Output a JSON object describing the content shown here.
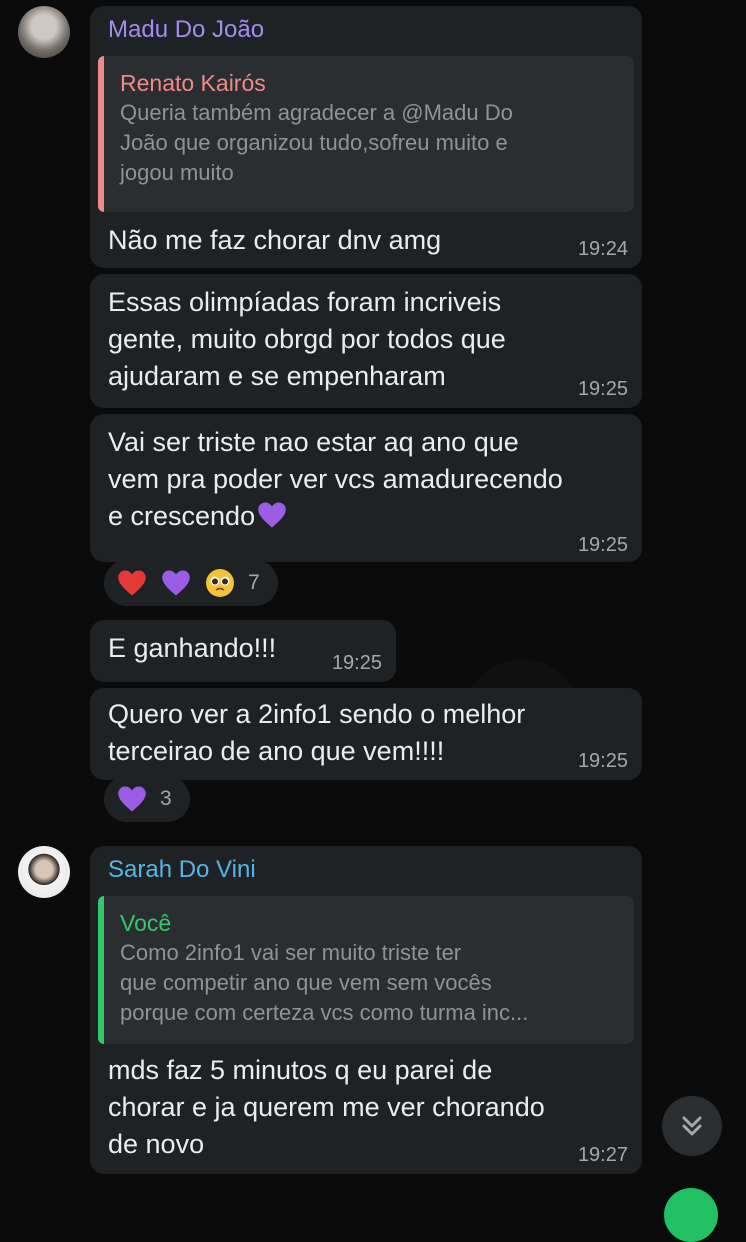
{
  "messages": [
    {
      "sender": "Madu Do João",
      "sender_color": "#a48cf0",
      "quote": {
        "name": "Renato Kairós",
        "name_color": "#f08a8a",
        "bar_color": "#f08a8a",
        "text": "Queria também agradecer a @Madu Do\nJoão que organizou tudo,sofreu muito e\njogou muito"
      },
      "text": "Não me faz chorar dnv amg",
      "time": "19:24"
    },
    {
      "text": "Essas olimpíadas foram incriveis\ngente, muito obrgd por todos que\najudaram e se empenharam",
      "time": "19:25"
    },
    {
      "text": "Vai ser triste nao estar aq ano que\nvem pra poder ver vcs amadurecendo\ne crescendo",
      "emoji": "purple-heart",
      "time": "19:25",
      "reactions": {
        "items": [
          "red-heart",
          "purple-heart",
          "pleading-face"
        ],
        "count": "7"
      }
    },
    {
      "text": "E ganhando!!!",
      "time": "19:25"
    },
    {
      "text": "Quero ver a 2info1 sendo o melhor\nterceirao de ano que vem!!!!",
      "time": "19:25",
      "reactions": {
        "items": [
          "purple-heart"
        ],
        "count": "3"
      }
    },
    {
      "sender": "Sarah Do Vini",
      "sender_color": "#56b5e8",
      "quote": {
        "name": "Você",
        "name_color": "#35c86a",
        "bar_color": "#35c86a",
        "text": "Como 2info1 vai ser muito triste ter\nque competir ano que vem sem vocês\nporque com certeza vcs como turma inc..."
      },
      "text": "mds faz 5 minutos q eu parei de\nchorar e ja querem me ver chorando\nde novo",
      "time": "19:27"
    }
  ],
  "scroll_button_icon": "double-chevron-down-icon"
}
